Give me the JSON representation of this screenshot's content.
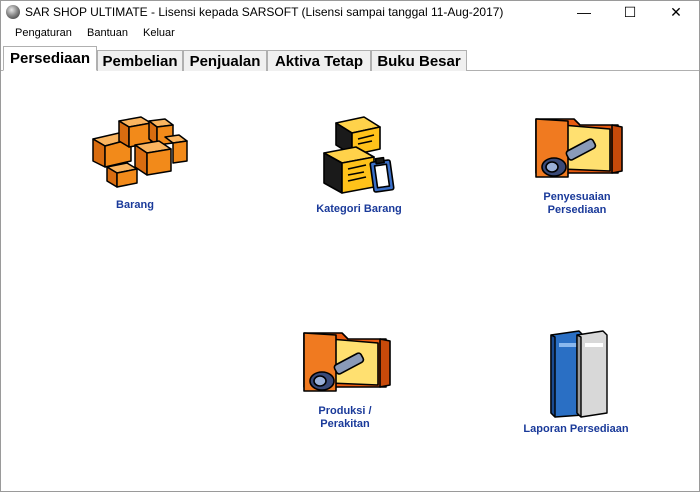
{
  "window": {
    "title": "SAR SHOP ULTIMATE - Lisensi kepada SARSOFT (Lisensi sampai tanggal 11-Aug-2017)",
    "minimize_glyph": "—",
    "maximize_glyph": "☐",
    "close_glyph": "✕"
  },
  "menu": {
    "items": [
      "Pengaturan",
      "Bantuan",
      "Keluar"
    ]
  },
  "tabs": {
    "items": [
      "Persediaan",
      "Pembelian",
      "Penjualan",
      "Aktiva Tetap",
      "Buku Besar"
    ],
    "active": "Persediaan"
  },
  "content": {
    "items": [
      {
        "label": "Barang",
        "icon": "boxes-icon"
      },
      {
        "label": "Kategori Barang",
        "icon": "box-clipboard-icon"
      },
      {
        "label": "Penyesuaian\nPersediaan",
        "icon": "folder-tool-icon"
      },
      {
        "label": "Produksi /\nPerakitan",
        "icon": "folder-tool-icon"
      },
      {
        "label": "Laporan Persediaan",
        "icon": "binders-icon"
      }
    ]
  },
  "colors": {
    "label": "#1a3a9a",
    "box_orange": "#f28a1a",
    "folder_orange": "#e85a10",
    "binder_blue": "#2a6fc4",
    "binder_grey": "#c8c8c8"
  }
}
